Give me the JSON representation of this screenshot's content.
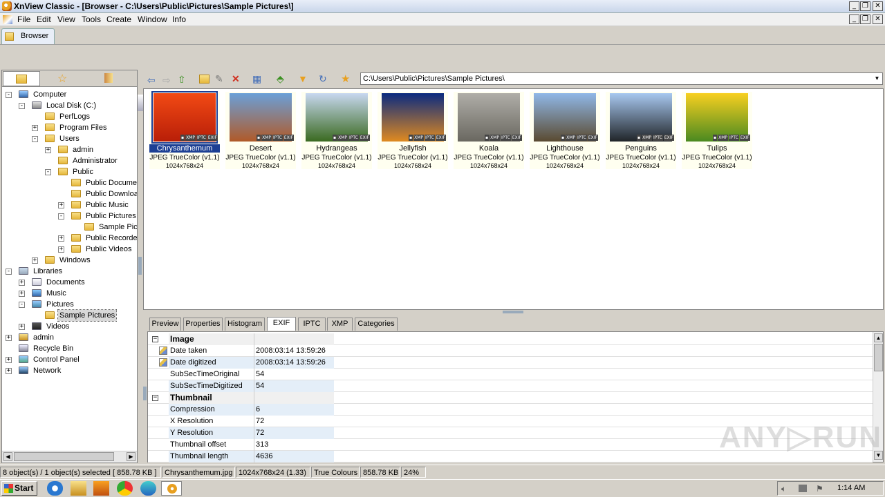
{
  "window": {
    "title": "XnView Classic - [Browser - C:\\Users\\Public\\Pictures\\Sample Pictures\\]",
    "min": "_",
    "restore": "❐",
    "close": "✕"
  },
  "menu": [
    "File",
    "Edit",
    "View",
    "Tools",
    "Create",
    "Window",
    "Info"
  ],
  "tabs": {
    "browser": "Browser"
  },
  "address": {
    "path": "C:\\Users\\Public\\Pictures\\Sample Pictures\\"
  },
  "tree": [
    {
      "label": "Computer",
      "indent": 0,
      "exp": "-",
      "icon": "computer"
    },
    {
      "label": "Local Disk (C:)",
      "indent": 1,
      "exp": "-",
      "icon": "drive"
    },
    {
      "label": "PerfLogs",
      "indent": 2,
      "exp": "",
      "icon": "folder"
    },
    {
      "label": "Program Files",
      "indent": 2,
      "exp": "+",
      "icon": "folder"
    },
    {
      "label": "Users",
      "indent": 2,
      "exp": "-",
      "icon": "folder"
    },
    {
      "label": "admin",
      "indent": 3,
      "exp": "+",
      "icon": "folder"
    },
    {
      "label": "Administrator",
      "indent": 3,
      "exp": "",
      "icon": "folder"
    },
    {
      "label": "Public",
      "indent": 3,
      "exp": "-",
      "icon": "folder"
    },
    {
      "label": "Public Documen",
      "indent": 4,
      "exp": "",
      "icon": "folder"
    },
    {
      "label": "Public Downloac",
      "indent": 4,
      "exp": "",
      "icon": "folder"
    },
    {
      "label": "Public Music",
      "indent": 4,
      "exp": "+",
      "icon": "folder"
    },
    {
      "label": "Public Pictures",
      "indent": 4,
      "exp": "-",
      "icon": "folder"
    },
    {
      "label": "Sample Pictu",
      "indent": 5,
      "exp": "",
      "icon": "folder"
    },
    {
      "label": "Public Recorded",
      "indent": 4,
      "exp": "+",
      "icon": "folder"
    },
    {
      "label": "Public Videos",
      "indent": 4,
      "exp": "+",
      "icon": "folder"
    },
    {
      "label": "Windows",
      "indent": 2,
      "exp": "+",
      "icon": "folder"
    },
    {
      "label": "Libraries",
      "indent": 0,
      "exp": "-",
      "icon": "library"
    },
    {
      "label": "Documents",
      "indent": 1,
      "exp": "+",
      "icon": "doc"
    },
    {
      "label": "Music",
      "indent": 1,
      "exp": "+",
      "icon": "music"
    },
    {
      "label": "Pictures",
      "indent": 1,
      "exp": "-",
      "icon": "pictures"
    },
    {
      "label": "Sample Pictures",
      "indent": 2,
      "exp": "",
      "icon": "folder",
      "selected": true
    },
    {
      "label": "Videos",
      "indent": 1,
      "exp": "+",
      "icon": "video"
    },
    {
      "label": "admin",
      "indent": 0,
      "exp": "+",
      "icon": "user"
    },
    {
      "label": "Recycle Bin",
      "indent": 0,
      "exp": "",
      "icon": "bin"
    },
    {
      "label": "Control Panel",
      "indent": 0,
      "exp": "+",
      "icon": "panel"
    },
    {
      "label": "Network",
      "indent": 0,
      "exp": "+",
      "icon": "network"
    }
  ],
  "thumbnails": [
    {
      "name": "Chrysanthemum",
      "format": "JPEG TrueColor (v1.1)",
      "dims": "1024x768x24",
      "selected": true,
      "colors": [
        "#f24a14",
        "#b81e08"
      ]
    },
    {
      "name": "Desert",
      "format": "JPEG TrueColor (v1.1)",
      "dims": "1024x768x24",
      "colors": [
        "#6aa0d8",
        "#b05a28"
      ]
    },
    {
      "name": "Hydrangeas",
      "format": "JPEG TrueColor (v1.1)",
      "dims": "1024x768x24",
      "colors": [
        "#c8d8f0",
        "#3a6a20"
      ]
    },
    {
      "name": "Jellyfish",
      "format": "JPEG TrueColor (v1.1)",
      "dims": "1024x768x24",
      "colors": [
        "#0a2a80",
        "#e08a20"
      ]
    },
    {
      "name": "Koala",
      "format": "JPEG TrueColor (v1.1)",
      "dims": "1024x768x24",
      "colors": [
        "#b0aea8",
        "#6a6860"
      ]
    },
    {
      "name": "Lighthouse",
      "format": "JPEG TrueColor (v1.1)",
      "dims": "1024x768x24",
      "colors": [
        "#90b8e8",
        "#5a4a30"
      ]
    },
    {
      "name": "Penguins",
      "format": "JPEG TrueColor (v1.1)",
      "dims": "1024x768x24",
      "colors": [
        "#a8c8f0",
        "#202428"
      ]
    },
    {
      "name": "Tulips",
      "format": "JPEG TrueColor (v1.1)",
      "dims": "1024x768x24",
      "colors": [
        "#f8d020",
        "#4a8a20"
      ]
    }
  ],
  "badges": [
    "▪",
    "XMP",
    "IPTC",
    "EXIF"
  ],
  "info_tabs": [
    "Preview",
    "Properties",
    "Histogram",
    "EXIF",
    "IPTC",
    "XMP",
    "Categories"
  ],
  "active_info_tab": "EXIF",
  "exif": [
    {
      "group": "Image",
      "box": "−"
    },
    {
      "key": "Date taken",
      "value": "2008:03:14 13:59:26",
      "editable": true
    },
    {
      "key": "Date digitized",
      "value": "2008:03:14 13:59:26",
      "editable": true
    },
    {
      "key": "SubSecTimeOriginal",
      "value": "54"
    },
    {
      "key": "SubSecTimeDigitized",
      "value": "54"
    },
    {
      "group": "Thumbnail",
      "box": "−"
    },
    {
      "key": "Compression",
      "value": "6"
    },
    {
      "key": "X Resolution",
      "value": "72"
    },
    {
      "key": "Y Resolution",
      "value": "72"
    },
    {
      "key": "Thumbnail offset",
      "value": "313"
    },
    {
      "key": "Thumbnail length",
      "value": "4636"
    }
  ],
  "status": {
    "objects": "8 object(s) / 1 object(s) selected  [ 858.78 KB ]",
    "filename": "Chrysanthemum.jpg",
    "dims": "1024x768x24 (1.33)",
    "colours": "True Colours",
    "size": "858.78 KB",
    "zoom": "24%"
  },
  "taskbar": {
    "start": "Start",
    "clock": "1:14 AM"
  },
  "watermark": "ANY▷RUN",
  "colors": {
    "selection": "#1c3f94",
    "thumb_bg": "#fffff0",
    "exif_alt": "#e4eef8"
  }
}
